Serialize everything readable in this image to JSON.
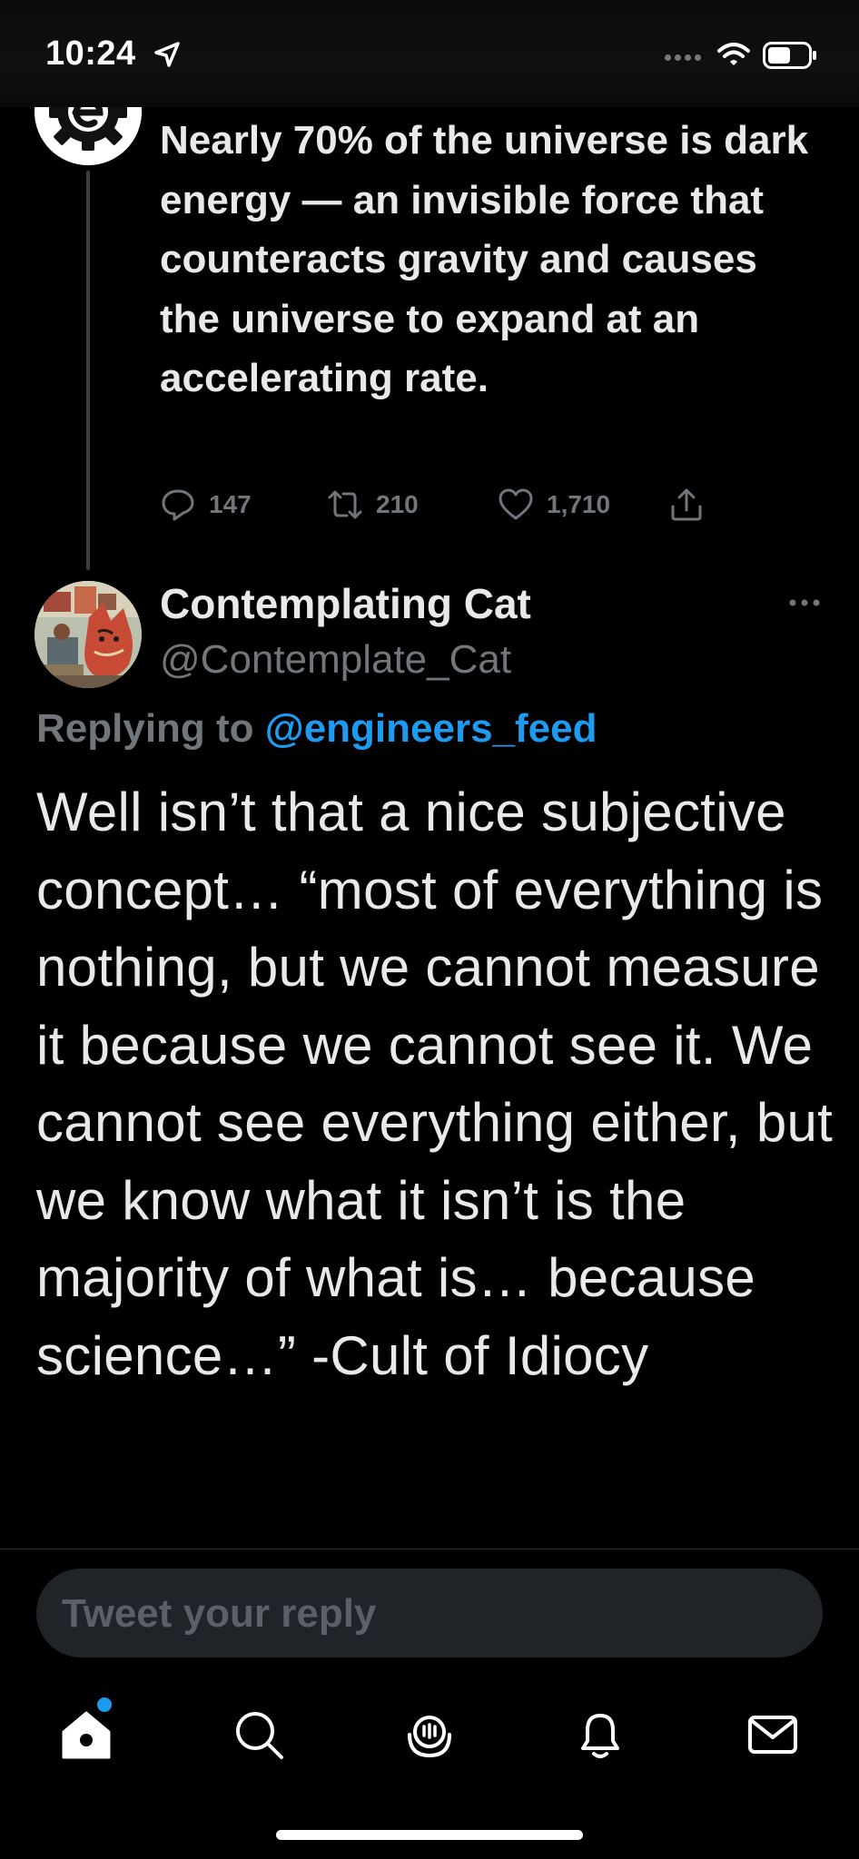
{
  "status_bar": {
    "time": "10:24"
  },
  "parent_tweet": {
    "text": "Nearly 70% of the universe is dark energy — an invisible force that counteracts gravity and causes the universe to expand at an accelerating rate.",
    "replies": "147",
    "retweets": "210",
    "likes": "1,710"
  },
  "reply_tweet": {
    "display_name": "Contemplating Cat",
    "handle": "@Contemplate_Cat",
    "replying_prefix": "Replying to",
    "replying_to": "@engineers_feed",
    "text": "Well isn’t that a nice subjective concept… “most of everything is nothing, but we cannot measure it because we cannot see it. We cannot see everything either, but we know what it isn’t is the majority of what is… because science…” -Cult of Idiocy"
  },
  "composer": {
    "placeholder": "Tweet your reply"
  },
  "tabbar": {
    "items": [
      "home-icon",
      "search-icon",
      "spaces-icon",
      "notifications-icon",
      "messages-icon"
    ],
    "home_has_new": true
  },
  "colors": {
    "background": "#000000",
    "text": "#e7e9ea",
    "muted": "#71767b",
    "accent": "#1d9bf0"
  }
}
